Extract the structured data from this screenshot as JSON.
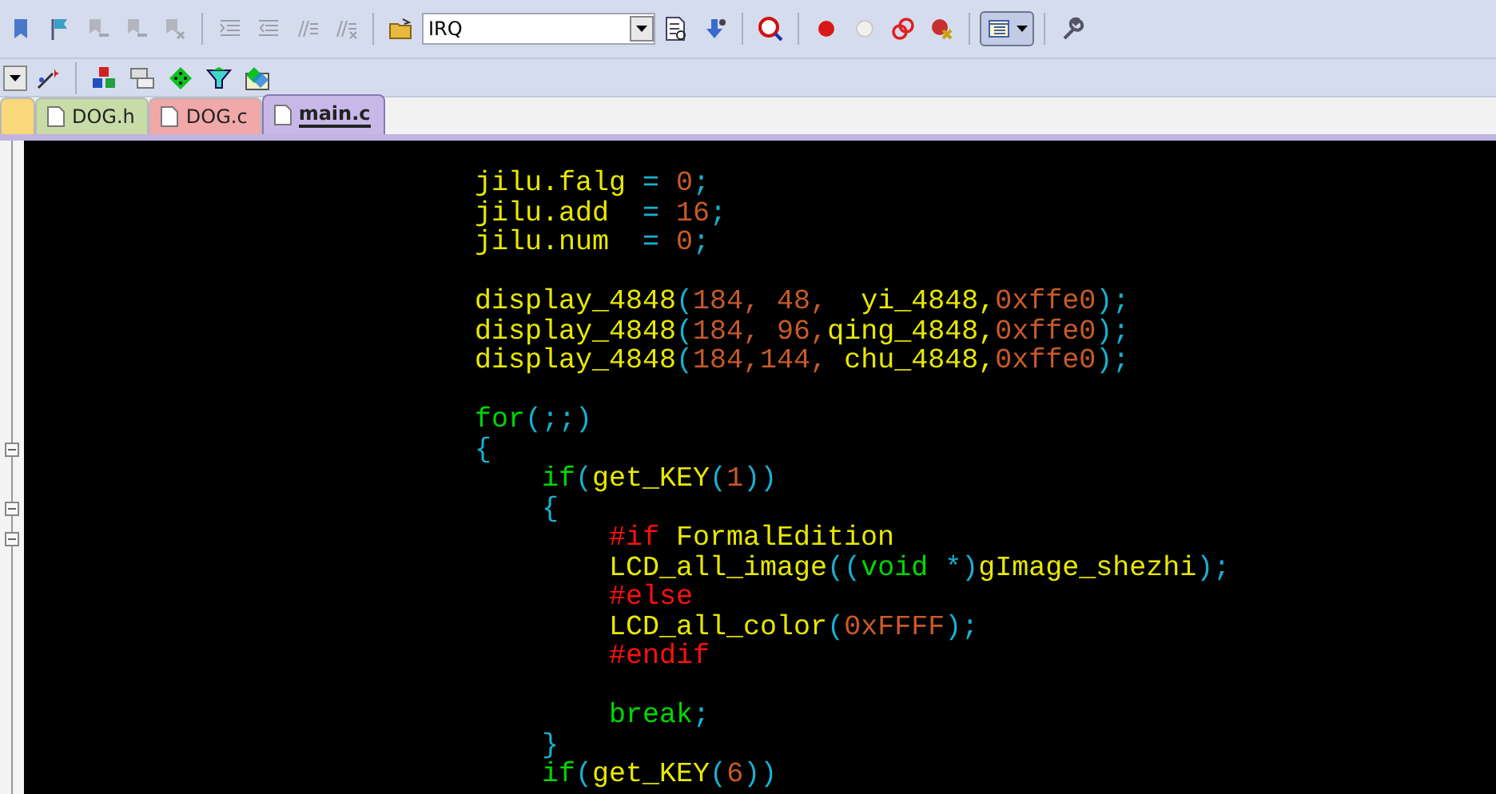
{
  "toolbar_top": [
    {
      "kind": "button",
      "disabled": false
    },
    {
      "kind": "button",
      "disabled": false
    },
    {
      "kind": "button",
      "disabled": true
    },
    {
      "kind": "button",
      "disabled": true
    },
    {
      "kind": "button",
      "disabled": true
    },
    {
      "kind": "separator"
    },
    {
      "kind": "button",
      "disabled": true
    },
    {
      "kind": "button",
      "disabled": true
    },
    {
      "kind": "button",
      "disabled": true
    },
    {
      "kind": "button",
      "disabled": true
    },
    {
      "kind": "separator"
    },
    {
      "kind": "button",
      "disabled": false
    },
    {
      "kind": "dropdown",
      "value": "IRQ"
    },
    {
      "kind": "button",
      "disabled": false
    },
    {
      "kind": "button",
      "disabled": false
    },
    {
      "kind": "separator"
    },
    {
      "kind": "button",
      "disabled": false
    },
    {
      "kind": "separator"
    },
    {
      "kind": "button",
      "disabled": false
    },
    {
      "kind": "button",
      "disabled": false
    },
    {
      "kind": "button",
      "disabled": false
    },
    {
      "kind": "button",
      "disabled": false
    },
    {
      "kind": "separator"
    },
    {
      "kind": "menu_button",
      "disabled": false
    },
    {
      "kind": "separator"
    },
    {
      "kind": "button",
      "disabled": false
    }
  ],
  "toolbar_bottom": [
    {
      "kind": "dropdown_caret"
    },
    {
      "kind": "button",
      "disabled": false
    },
    {
      "kind": "separator"
    },
    {
      "kind": "button",
      "disabled": false
    },
    {
      "kind": "button",
      "disabled": false
    },
    {
      "kind": "button",
      "disabled": false
    },
    {
      "kind": "button",
      "disabled": false
    },
    {
      "kind": "button",
      "disabled": false
    }
  ],
  "tabs": [
    {
      "selected": false,
      "color": "#f8d878"
    },
    {
      "label": "DOG.h",
      "selected": false,
      "color": "#c8dca8"
    },
    {
      "label": "DOG.c",
      "selected": false,
      "color": "#f0a8a8"
    },
    {
      "label": "main.c",
      "selected": true,
      "color": "#c8b8e8"
    }
  ],
  "code_lines": [
    {
      "fold": false,
      "tokens": [
        {
          "kind": "text",
          "text": "jilu.falg"
        },
        {
          "kind": "punct",
          "text": " = "
        },
        {
          "kind": "number",
          "text": "0"
        },
        {
          "kind": "punct",
          "text": ";"
        }
      ]
    },
    {
      "fold": false,
      "tokens": [
        {
          "kind": "text",
          "text": "jilu.add"
        },
        {
          "kind": "punct",
          "text": "  = "
        },
        {
          "kind": "number",
          "text": "16"
        },
        {
          "kind": "punct",
          "text": ";"
        }
      ]
    },
    {
      "fold": false,
      "tokens": [
        {
          "kind": "text",
          "text": "jilu.num"
        },
        {
          "kind": "punct",
          "text": "  = "
        },
        {
          "kind": "number",
          "text": "0"
        },
        {
          "kind": "punct",
          "text": ";"
        }
      ]
    },
    {
      "fold": false
    },
    {
      "fold": false,
      "tokens": [
        {
          "kind": "text",
          "text": "display_4848"
        },
        {
          "kind": "punct",
          "text": "("
        },
        {
          "kind": "number",
          "text": "184, 48,  "
        },
        {
          "kind": "text",
          "text": "yi_4848,"
        },
        {
          "kind": "number",
          "text": "0xffe0"
        },
        {
          "kind": "punct",
          "text": ");"
        }
      ]
    },
    {
      "fold": false,
      "tokens": [
        {
          "kind": "text",
          "text": "display_4848"
        },
        {
          "kind": "punct",
          "text": "("
        },
        {
          "kind": "number",
          "text": "184, 96,"
        },
        {
          "kind": "text",
          "text": "qing_4848,"
        },
        {
          "kind": "number",
          "text": "0xffe0"
        },
        {
          "kind": "punct",
          "text": ");"
        }
      ]
    },
    {
      "fold": false,
      "tokens": [
        {
          "kind": "text",
          "text": "display_4848"
        },
        {
          "kind": "punct",
          "text": "("
        },
        {
          "kind": "number",
          "text": "184,144, "
        },
        {
          "kind": "text",
          "text": "chu_4848,"
        },
        {
          "kind": "number",
          "text": "0xffe0"
        },
        {
          "kind": "punct",
          "text": ");"
        }
      ]
    },
    {
      "fold": false
    },
    {
      "fold": false,
      "tokens": [
        {
          "kind": "keyword",
          "text": "for"
        },
        {
          "kind": "punct",
          "text": "(;;)"
        }
      ]
    },
    {
      "fold": true,
      "tokens": [
        {
          "kind": "punct",
          "text": "{"
        }
      ]
    },
    {
      "fold": false,
      "tokens": [
        {
          "kind": "keyword",
          "text": "    if"
        },
        {
          "kind": "punct",
          "text": "("
        },
        {
          "kind": "text",
          "text": "get_KEY"
        },
        {
          "kind": "punct",
          "text": "("
        },
        {
          "kind": "number",
          "text": "1"
        },
        {
          "kind": "punct",
          "text": "))"
        }
      ]
    },
    {
      "fold": true,
      "tokens": [
        {
          "kind": "punct",
          "text": "    {"
        }
      ]
    },
    {
      "fold": true,
      "tokens": [
        {
          "kind": "directive",
          "text": "        #if "
        },
        {
          "kind": "text",
          "text": "FormalEdition"
        }
      ]
    },
    {
      "fold": false,
      "tokens": [
        {
          "kind": "text",
          "text": "        LCD_all_image"
        },
        {
          "kind": "punct",
          "text": "(("
        },
        {
          "kind": "keyword",
          "text": "void"
        },
        {
          "kind": "punct",
          "text": " *)"
        },
        {
          "kind": "text",
          "text": "gImage_shezhi"
        },
        {
          "kind": "punct",
          "text": ");"
        }
      ]
    },
    {
      "fold": false,
      "tokens": [
        {
          "kind": "directive",
          "text": "        #else"
        }
      ]
    },
    {
      "fold": false,
      "tokens": [
        {
          "kind": "text",
          "text": "        LCD_all_color"
        },
        {
          "kind": "punct",
          "text": "("
        },
        {
          "kind": "number",
          "text": "0xFFFF"
        },
        {
          "kind": "punct",
          "text": ");"
        }
      ]
    },
    {
      "fold": false,
      "tokens": [
        {
          "kind": "directive",
          "text": "        #endif"
        }
      ]
    },
    {
      "fold": false
    },
    {
      "fold": false,
      "tokens": [
        {
          "kind": "keyword",
          "text": "        break"
        },
        {
          "kind": "punct",
          "text": ";"
        }
      ]
    },
    {
      "fold": false,
      "tokens": [
        {
          "kind": "punct",
          "text": "    }"
        }
      ]
    },
    {
      "fold": false,
      "tokens": [
        {
          "kind": "keyword",
          "text": "    if"
        },
        {
          "kind": "punct",
          "text": "("
        },
        {
          "kind": "text",
          "text": "get_KEY"
        },
        {
          "kind": "punct",
          "text": "("
        },
        {
          "kind": "number",
          "text": "6"
        },
        {
          "kind": "punct",
          "text": "))"
        }
      ]
    }
  ]
}
